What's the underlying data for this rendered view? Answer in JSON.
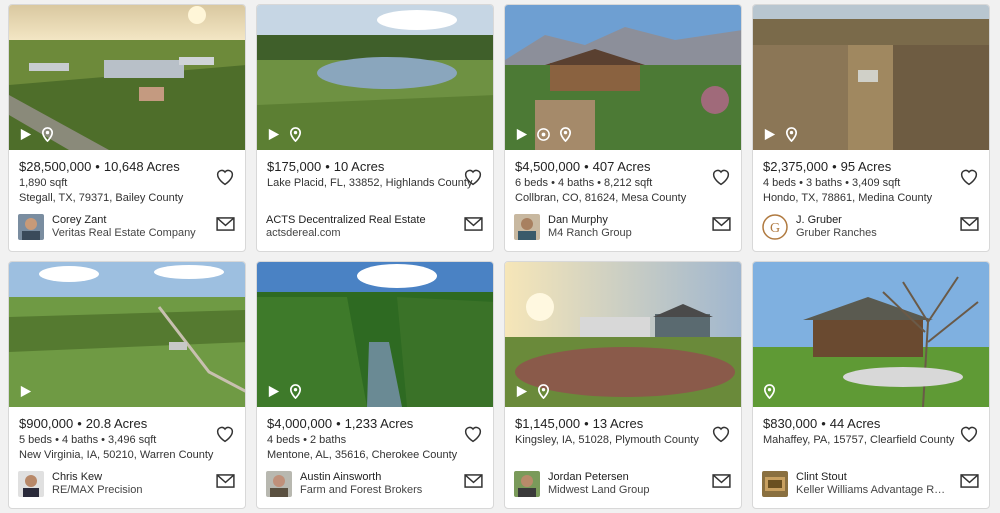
{
  "listings": [
    {
      "price": "$28,500,000",
      "acres": "10,648 Acres",
      "specs": "1,890 sqft",
      "location": "Stegall, TX, 79371, Bailey County",
      "agent_name": "Corey Zant",
      "agent_company": "Veritas Real Estate Company",
      "media_icons": [
        "play-icon",
        "map-pin-icon"
      ],
      "photo_colors": [
        "#e9d9b0",
        "#6f8b3c",
        "#3f5f25"
      ]
    },
    {
      "price": "$175,000",
      "acres": "10 Acres",
      "specs": "",
      "location": "Lake Placid, FL, 33852, Highlands County",
      "agent_name": "ACTS Decentralized Real Estate",
      "agent_company": "actsdereal.com",
      "media_icons": [
        "play-icon",
        "map-pin-icon"
      ],
      "photo_colors": [
        "#c9d9e6",
        "#6e8f4a",
        "#7fa0b5"
      ]
    },
    {
      "price": "$4,500,000",
      "acres": "407 Acres",
      "specs": "6 beds • 4 baths • 8,212 sqft",
      "location": "Collbran, CO, 81624, Mesa County",
      "agent_name": "Dan Murphy",
      "agent_company": "M4 Ranch Group",
      "media_icons": [
        "play-icon",
        "360-icon",
        "map-pin-icon"
      ],
      "photo_colors": [
        "#6f9ed0",
        "#4f7a3a",
        "#8a6a4a"
      ]
    },
    {
      "price": "$2,375,000",
      "acres": "95 Acres",
      "specs": "4 beds • 3 baths • 3,409 sqft",
      "location": "Hondo, TX, 78861, Medina County",
      "agent_name": "J. Gruber",
      "agent_company": "Gruber Ranches",
      "media_icons": [
        "play-icon",
        "map-pin-icon"
      ],
      "photo_colors": [
        "#b9c6cf",
        "#8c7a5c",
        "#6b5a40"
      ]
    },
    {
      "price": "$900,000",
      "acres": "20.8 Acres",
      "specs": "5 beds • 4 baths • 3,496 sqft",
      "location": "New Virginia, IA, 50210, Warren County",
      "agent_name": "Chris Kew",
      "agent_company": "RE/MAX Precision",
      "media_icons": [
        "play-icon"
      ],
      "photo_colors": [
        "#8fb4dd",
        "#6f9a44",
        "#4c7a30"
      ]
    },
    {
      "price": "$4,000,000",
      "acres": "1,233 Acres",
      "specs": "4 beds • 2 baths",
      "location": "Mentone, AL, 35616, Cherokee County",
      "agent_name": "Austin Ainsworth",
      "agent_company": "Farm and Forest Brokers",
      "media_icons": [
        "play-icon",
        "map-pin-icon"
      ],
      "photo_colors": [
        "#4f86c6",
        "#2f6a22",
        "#5a7a86"
      ]
    },
    {
      "price": "$1,145,000",
      "acres": "13 Acres",
      "specs": "",
      "location": "Kingsley, IA, 51028, Plymouth County",
      "agent_name": "Jordan Petersen",
      "agent_company": "Midwest Land Group",
      "media_icons": [
        "play-icon",
        "map-pin-icon"
      ],
      "photo_colors": [
        "#e8d7a8",
        "#6a8a3a",
        "#8a5a4a"
      ]
    },
    {
      "price": "$830,000",
      "acres": "44 Acres",
      "specs": "",
      "location": "Mahaffey, PA, 15757, Clearfield County",
      "agent_name": "Clint Stout",
      "agent_company": "Keller Williams Advantage Realty - ...",
      "media_icons": [
        "map-pin-icon"
      ],
      "photo_colors": [
        "#7fb0e0",
        "#5f9a35",
        "#6a4a30"
      ]
    }
  ],
  "separator": "•"
}
